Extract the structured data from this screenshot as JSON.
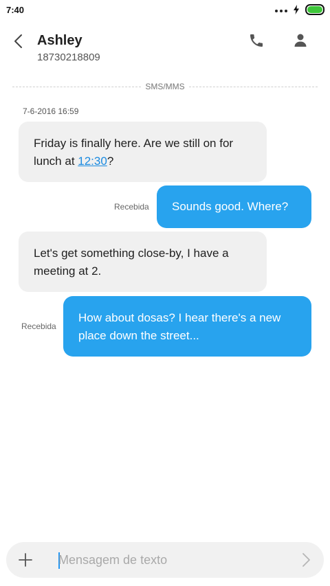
{
  "status_bar": {
    "time": "7:40",
    "battery_color": "#3ec63a"
  },
  "header": {
    "contact_name": "Ashley",
    "contact_number": "18730218809",
    "icons": [
      "back-arrow-icon",
      "phone-icon",
      "person-icon"
    ]
  },
  "conversation": {
    "channel_label": "SMS/MMS",
    "timestamp": "7-6-2016 16:59",
    "messages": [
      {
        "direction": "incoming",
        "text_before": "Friday is finally here. Are we still on for lunch at ",
        "link": "12:30",
        "text_after": "?"
      },
      {
        "direction": "outgoing",
        "text": "Sounds good. Where?",
        "status": "Recebida"
      },
      {
        "direction": "incoming",
        "text": "Let's get something close-by, I have a meeting at 2."
      },
      {
        "direction": "outgoing",
        "text": "How about dosas? I hear there's a new place down the street...",
        "status": "Recebida"
      }
    ]
  },
  "composer": {
    "placeholder": "Mensagem de texto",
    "value": "",
    "icons": [
      "plus-icon",
      "send-arrow-icon"
    ]
  },
  "colors": {
    "outgoing_bubble": "#28a3ee",
    "incoming_bubble": "#f0f0f0",
    "link": "#1a8ae0"
  }
}
